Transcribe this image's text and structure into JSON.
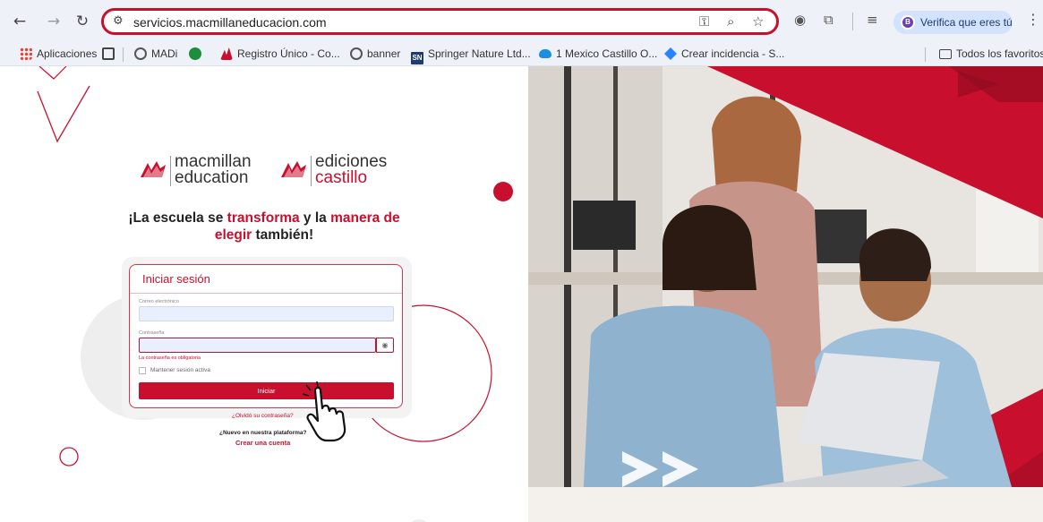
{
  "browser": {
    "nav": {
      "back": "←",
      "forward": "→",
      "reload": "↻"
    },
    "url": "servicios.macmillaneducacion.com",
    "omnibox_icons": [
      "key-icon",
      "zoom-icon",
      "star-icon"
    ],
    "verify_chip": {
      "avatar_letter": "B",
      "label": "Verifica que eres tú"
    }
  },
  "bookmarks": {
    "apps_label": "Aplicaciones",
    "items": [
      {
        "label": "MADi",
        "icon": "globe-icon",
        "color": "#555555"
      },
      {
        "label": "",
        "icon": "sheets-icon",
        "color": "#1e8e3e"
      },
      {
        "label": "Registro Único - Co...",
        "icon": "macmillan-icon",
        "color": "#c8102e"
      },
      {
        "label": "banner",
        "icon": "globe-icon",
        "color": "#555555"
      },
      {
        "label": "Springer Nature Ltd...",
        "icon": "sn-icon",
        "color": "#1f3b6f"
      },
      {
        "label": "1 Mexico Castillo O...",
        "icon": "cloud-icon",
        "color": "#1a8fe3"
      },
      {
        "label": "Crear incidencia - S...",
        "icon": "jira-icon",
        "color": "#2684ff"
      }
    ],
    "all_bookmarks": "Todos los favoritos"
  },
  "brand": {
    "logo1_line1": "macmillan",
    "logo1_line2": "education",
    "logo2_line1": "ediciones",
    "logo2_line2": "castillo",
    "accent": "#c8102e"
  },
  "headline": {
    "part1": "¡La escuela se ",
    "hl1": "transforma",
    "part2": " y la ",
    "hl2": "manera de elegir",
    "part3": " también!"
  },
  "login": {
    "title": "Iniciar sesión",
    "email_label": "Correo electrónico",
    "email_value": "",
    "password_label": "Contraseña",
    "password_value": "",
    "password_error": "La contraseña es obligatoria",
    "remember_label": "Mantener sesión activa",
    "remember_checked": false,
    "submit_label": "Iniciar",
    "forgot_link": "¿Olvidó su contraseña?",
    "signup_question": "¿Nuevo en nuestra plataforma?",
    "signup_link": "Crear una cuenta"
  },
  "hero_image": {
    "description_icon": "photo-people-laptop",
    "arrow_glyph": ">>"
  }
}
